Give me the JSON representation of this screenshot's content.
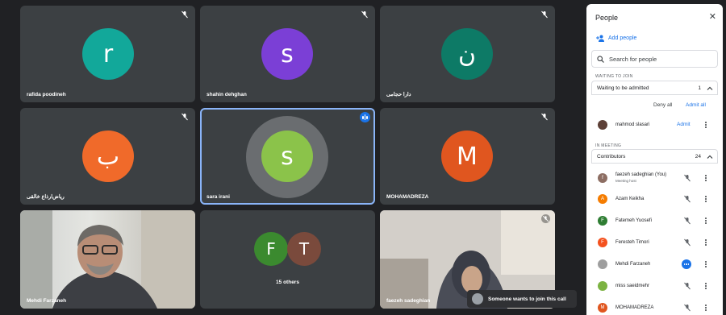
{
  "tiles": [
    {
      "name": "rafida poodineh",
      "initial": "r",
      "color": "#12a89a"
    },
    {
      "name": "shahin dehghan",
      "initial": "s",
      "color": "#7b3fd6"
    },
    {
      "name": "دارا حجامی",
      "initial": "ن",
      "color": "#0d7a66"
    },
    {
      "name": "ریاض‌ارذاع خالقی",
      "initial": "ب",
      "color": "#f06a2a"
    },
    {
      "name": "sara irani",
      "initial": "s",
      "color": "#8bc34a"
    },
    {
      "name": "MOHAMADREZA",
      "initial": "M",
      "color": "#e0561f"
    },
    {
      "name": "Mehdi Farzaneh"
    },
    {
      "name": "15 others",
      "initials": [
        "F",
        "T"
      ],
      "colors": [
        "#3b8a2f",
        "#7a4a3c"
      ]
    },
    {
      "name": "faezeh sadeghian"
    }
  ],
  "toast": {
    "text": "Someone wants to join this call"
  },
  "panel": {
    "title": "People",
    "add_people": "Add people",
    "search_placeholder": "Search for people",
    "waiting_section": "WAITING TO JOIN",
    "waiting_group": "Waiting to be admitted",
    "waiting_count": "1",
    "deny_all": "Deny all",
    "admit_all": "Admit all",
    "waiting_person": "mahmod slasari",
    "admit": "Admit",
    "in_meeting_section": "IN MEETING",
    "contributors_label": "Contributors",
    "contributors_count": "24",
    "participants": [
      {
        "name": "faezeh sadeghian (You)",
        "sub": "Meeting host",
        "initial": "f",
        "color": "#8d6e63"
      },
      {
        "name": "Azam Keikha",
        "initial": "A",
        "color": "#f57c00"
      },
      {
        "name": "Fatemeh Yuosefi",
        "initial": "F",
        "color": "#2e7d32"
      },
      {
        "name": "Feresteh Timori",
        "initial": "F",
        "color": "#f4511e"
      },
      {
        "name": "Mehdi Farzaneh",
        "initial": "",
        "color": "#9e9e9e"
      },
      {
        "name": "miss saeidmehr",
        "initial": "",
        "color": "#7cb342"
      },
      {
        "name": "MOHAMADREZA",
        "initial": "M",
        "color": "#e0561f"
      }
    ]
  }
}
